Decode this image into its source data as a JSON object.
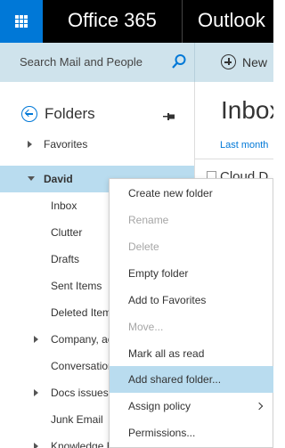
{
  "header": {
    "brand": "Office 365",
    "app_name": "Outlook",
    "launcher_icon": "waffle-icon"
  },
  "search": {
    "placeholder": "Search Mail and People",
    "icon": "search-icon"
  },
  "commands": {
    "new_label": "New",
    "new_icon": "plus-circle-icon"
  },
  "folder_pane": {
    "title": "Folders",
    "back_icon": "back-arrow-icon",
    "pin_icon": "pin-icon",
    "items": [
      {
        "label": "Favorites"
      },
      {
        "label": "David"
      },
      {
        "label": "Inbox"
      },
      {
        "label": "Clutter"
      },
      {
        "label": "Drafts"
      },
      {
        "label": "Sent Items"
      },
      {
        "label": "Deleted Items"
      },
      {
        "label": "Company, ac"
      },
      {
        "label": "Conversation"
      },
      {
        "label": "Docs issues"
      },
      {
        "label": "Junk Email"
      },
      {
        "label": "Knowledge Ba"
      }
    ]
  },
  "mail_list": {
    "title": "Inbox",
    "filter": "Last month",
    "first_sender": "Cloud D"
  },
  "context_menu": {
    "items": [
      {
        "label": "Create new folder",
        "enabled": true
      },
      {
        "label": "Rename",
        "enabled": false
      },
      {
        "label": "Delete",
        "enabled": false
      },
      {
        "label": "Empty folder",
        "enabled": true
      },
      {
        "label": "Add to Favorites",
        "enabled": true
      },
      {
        "label": "Move...",
        "enabled": false
      },
      {
        "label": "Mark all as read",
        "enabled": true
      },
      {
        "label": "Add shared folder...",
        "enabled": true,
        "highlighted": true
      },
      {
        "label": "Assign policy",
        "enabled": true,
        "has_submenu": true
      },
      {
        "label": "Permissions...",
        "enabled": true
      }
    ]
  },
  "colors": {
    "accent": "#0078d7",
    "topbar": "#000000",
    "selection": "#b9dcef",
    "searchbar": "#cfe3ec"
  }
}
